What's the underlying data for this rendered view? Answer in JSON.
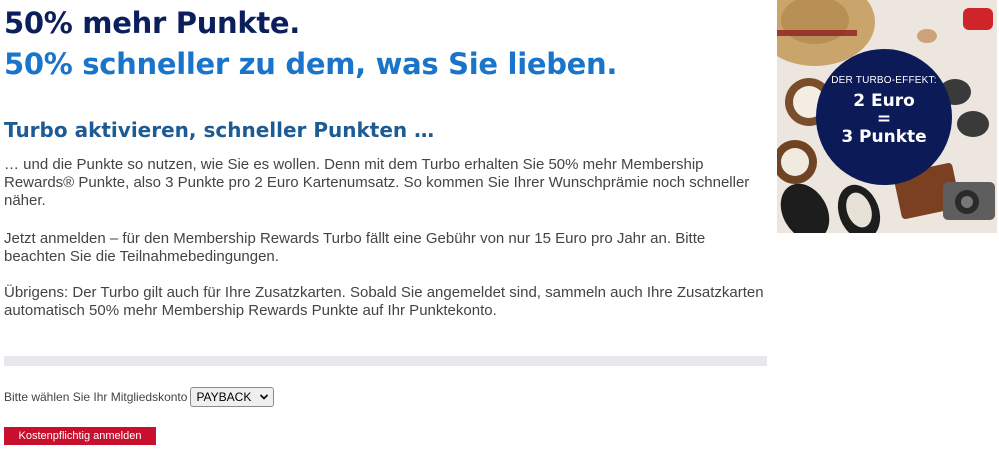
{
  "heading": {
    "line1": "50% mehr Punkte.",
    "line2": "50% schneller zu dem, was Sie lieben."
  },
  "subheading": "Turbo aktivieren, schneller Punkten …",
  "paragraphs": [
    "… und die Punkte so nutzen, wie Sie es wollen. Denn mit dem Turbo erhalten Sie 50% mehr Membership Rewards® Punkte, also 3 Punkte pro 2 Euro Kartenumsatz. So kommen Sie Ihrer Wunschprämie noch schneller näher.",
    "Jetzt anmelden – für den Membership Rewards Turbo fällt eine Gebühr von nur 15 Euro pro Jahr an. Bitte beachten Sie die Teilnahmebedingungen.",
    "Übrigens: Der Turbo gilt auch für Ihre Zusatzkarten. Sobald Sie angemeldet sind, sammeln auch Ihre Zusatzkarten automatisch 50% mehr Membership Rewards Punkte auf Ihr Punktekonto."
  ],
  "account_select": {
    "label": "Bitte wählen Sie Ihr Mitgliedskonto",
    "selected": "PAYBACK"
  },
  "register_button": "Kostenpflichtig anmelden",
  "promo": {
    "badge_title": "DER TURBO-EFFEKT:",
    "badge_line1": "2 Euro",
    "badge_line2": "=",
    "badge_line3": "3 Punkte"
  },
  "colors": {
    "heading_dark": "#0a1f5c",
    "heading_blue": "#1a74c9",
    "subheading": "#1e5b94",
    "button": "#c8102e",
    "badge": "#0c1b57"
  }
}
